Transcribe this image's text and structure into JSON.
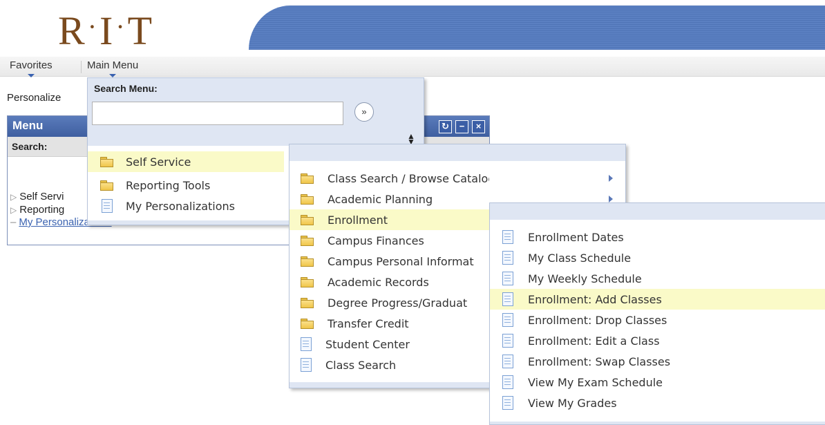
{
  "header": {
    "logo_text": "R·I·T",
    "logo_parts": [
      "R",
      "I",
      "T"
    ]
  },
  "nav": {
    "favorites_label": "Favorites",
    "main_menu_label": "Main Menu"
  },
  "page": {
    "personalize_text": "Personalize"
  },
  "menu_pagelet": {
    "title": "Menu",
    "search_label": "Search:",
    "icons": [
      "refresh-icon",
      "minimize-icon",
      "close-icon"
    ],
    "tree": [
      {
        "label": "Self Servi",
        "type": "collapsed"
      },
      {
        "label": "Reporting",
        "type": "collapsed"
      },
      {
        "label": "My Personalizations",
        "type": "link"
      }
    ]
  },
  "main_menu_dropdown": {
    "search_label": "Search Menu:",
    "search_value": "",
    "items": [
      {
        "label": "Self Service",
        "icon": "folder",
        "active": true
      },
      {
        "label": "Reporting Tools",
        "icon": "folder",
        "active": false
      },
      {
        "label": "My Personalizations",
        "icon": "document",
        "active": false
      }
    ]
  },
  "self_service_dropdown": {
    "items": [
      {
        "label": "Class Search / Browse Catalog",
        "icon": "folder",
        "submenu": true,
        "active": false
      },
      {
        "label": "Academic Planning",
        "icon": "folder",
        "submenu": true,
        "active": false
      },
      {
        "label": "Enrollment",
        "icon": "folder",
        "submenu": false,
        "active": true
      },
      {
        "label": "Campus Finances",
        "icon": "folder",
        "submenu": false,
        "active": false
      },
      {
        "label": "Campus Personal Informat",
        "icon": "folder",
        "submenu": false,
        "active": false
      },
      {
        "label": "Academic Records",
        "icon": "folder",
        "submenu": false,
        "active": false
      },
      {
        "label": "Degree Progress/Graduat",
        "icon": "folder",
        "submenu": false,
        "active": false
      },
      {
        "label": "Transfer Credit",
        "icon": "folder",
        "submenu": false,
        "active": false
      },
      {
        "label": "Student Center",
        "icon": "document",
        "submenu": false,
        "active": false
      },
      {
        "label": "Class Search",
        "icon": "document",
        "submenu": false,
        "active": false
      }
    ]
  },
  "enrollment_dropdown": {
    "items": [
      {
        "label": "Enrollment Dates",
        "icon": "document",
        "active": false
      },
      {
        "label": "My Class Schedule",
        "icon": "document",
        "active": false
      },
      {
        "label": "My Weekly Schedule",
        "icon": "document",
        "active": false
      },
      {
        "label": "Enrollment: Add Classes",
        "icon": "document",
        "active": true
      },
      {
        "label": "Enrollment: Drop Classes",
        "icon": "document",
        "active": false
      },
      {
        "label": "Enrollment: Edit a Class",
        "icon": "document",
        "active": false
      },
      {
        "label": "Enrollment: Swap Classes",
        "icon": "document",
        "active": false
      },
      {
        "label": "View My Exam Schedule",
        "icon": "document",
        "active": false
      },
      {
        "label": "View My Grades",
        "icon": "document",
        "active": false
      }
    ]
  },
  "colors": {
    "banner": "#4f74b6",
    "logo": "#7a4a1e",
    "highlight": "#fafac8",
    "dropdown_bg": "#dfe6f3",
    "link": "#3a62b0"
  }
}
